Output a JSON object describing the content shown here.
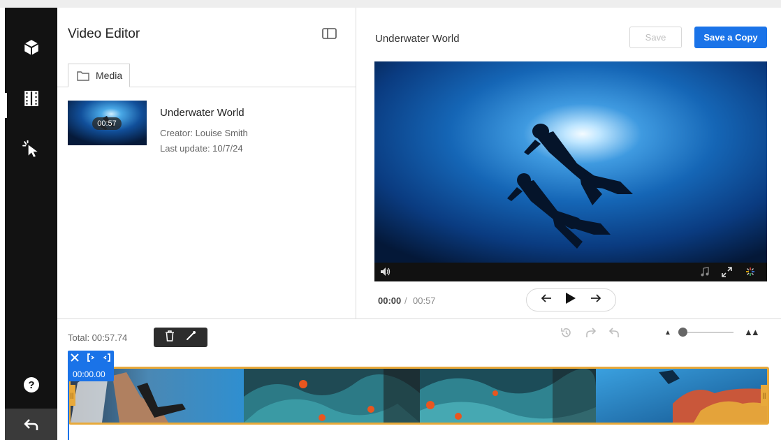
{
  "sidebar": {
    "items": [
      {
        "icon": "cube-icon"
      },
      {
        "icon": "film-icon",
        "active": true
      },
      {
        "icon": "cursor-click-icon"
      }
    ],
    "help_icon": "help-icon",
    "back_icon": "back-arrow-icon"
  },
  "editor": {
    "title": "Video Editor",
    "tab_label": "Media",
    "media_item": {
      "name": "Underwater World",
      "duration": "00:57",
      "creator": "Creator: Louise Smith",
      "last_update": "Last update: 10/7/24"
    }
  },
  "preview": {
    "title": "Underwater World",
    "save_label": "Save",
    "save_copy_label": "Save a Copy",
    "current_time": "00:00",
    "separator": "/",
    "total_time": "00:57"
  },
  "timeline": {
    "total_label": "Total: 00:57.74",
    "playhead_time": "00:00.00"
  },
  "colors": {
    "accent": "#1a73e8",
    "clip_border": "#e8a93a",
    "sidebar_bg": "#121212"
  }
}
